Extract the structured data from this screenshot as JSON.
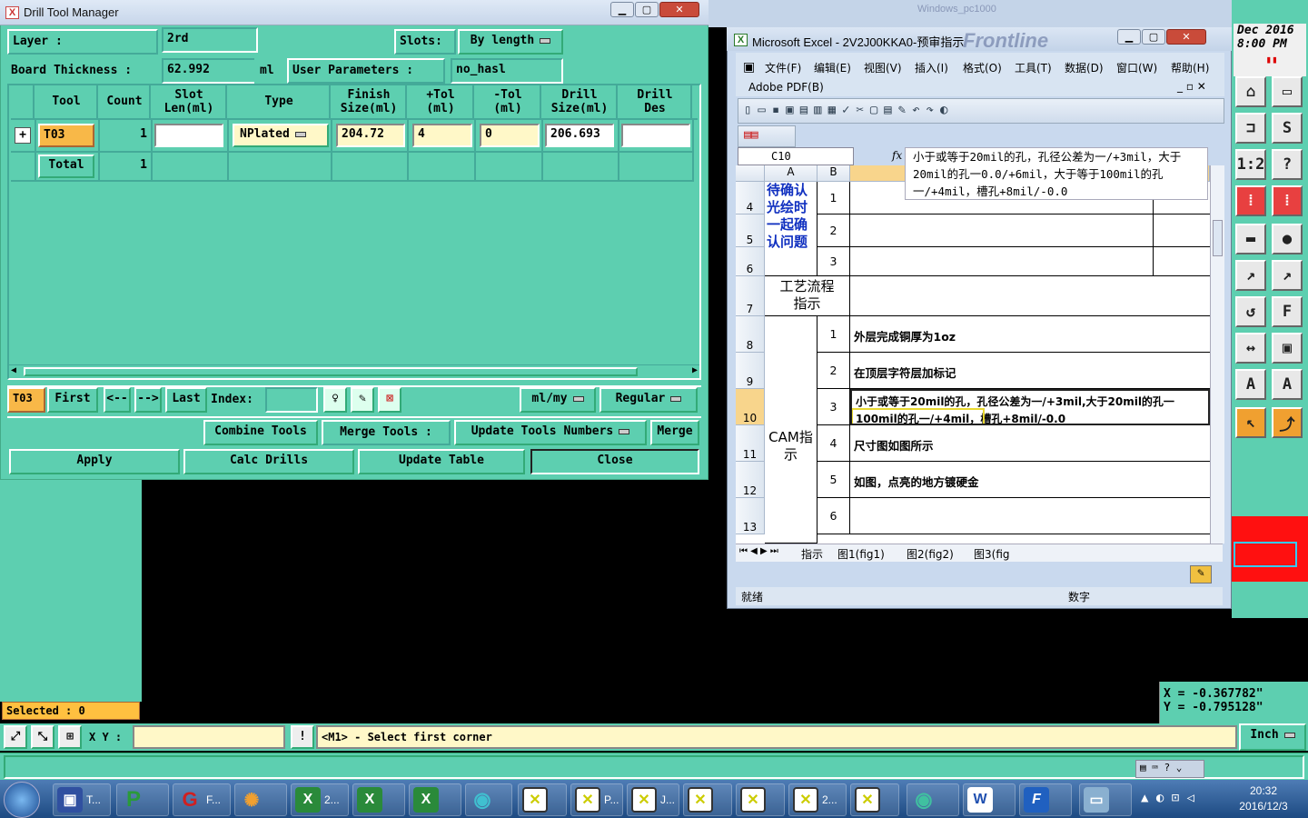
{
  "dtm": {
    "title": "Drill Tool Manager",
    "layer_label": "Layer :",
    "layer_value": "2rd",
    "slots_label": "Slots:",
    "slots_value": "By length",
    "board_thickness_label": "Board Thickness :",
    "board_thickness_value": "62.992",
    "board_thickness_unit": "ml",
    "user_params_label": "User Parameters :",
    "user_params_value": "no_hasl",
    "columns": [
      "Tool",
      "Count",
      "Slot\nLen(ml)",
      "Type",
      "Finish\nSize(ml)",
      "+Tol\n(ml)",
      "-Tol\n(ml)",
      "Drill\nSize(ml)",
      "Drill\nDes"
    ],
    "row1": {
      "tool": "T03",
      "count": "1",
      "slot_len": "",
      "type": "NPlated",
      "finish": "204.72",
      "ptol": "4",
      "ntol": "0",
      "drill": "206.693",
      "des": ""
    },
    "total_label": "Total",
    "total_count": "1",
    "nav_current": "T03",
    "nav_first": "First",
    "nav_prev": "<--",
    "nav_next": "-->",
    "nav_last": "Last",
    "index_label": "Index:",
    "unit_select": "ml/my",
    "mode_select": "Regular",
    "combine": "Combine Tools",
    "merge_tools": "Merge Tools :",
    "update_numbers": "Update Tools Numbers",
    "merge": "Merge",
    "apply": "Apply",
    "calc": "Calc Drills",
    "update_table": "Update Table",
    "close": "Close"
  },
  "genesis": {
    "date": "Dec 2016",
    "time": "8:00 PM",
    "coord_x": "X = -0.367782\"",
    "coord_y": "Y = -0.795128\"",
    "selected": "Selected : 0",
    "xy_label": "X Y :",
    "prompt": "<M1> - Select first corner",
    "unit": "Inch",
    "bg_logo": "Frontline",
    "bg_title": "Windows_pc1000"
  },
  "excel": {
    "title": "Microsoft Excel - 2V2J00KKA0-预审指示",
    "menus": [
      "文件(F)",
      "编辑(E)",
      "视图(V)",
      "插入(I)",
      "格式(O)",
      "工具(T)",
      "数据(D)",
      "窗口(W)",
      "帮助(H)"
    ],
    "adobe": "Adobe PDF(B)",
    "namebox": "C10",
    "fx": "fx",
    "formula": "小于或等于20mil的孔，孔径公差为一/+3mil，大于20mil的孔一0.0/+6mil，大于等于100mil的孔一/+4mil，槽孔+8mil/-0.0",
    "col_heads": [
      "A",
      "B",
      "C"
    ],
    "row_nums": [
      "4",
      "5",
      "6",
      "7",
      "8",
      "9",
      "10",
      "11",
      "12",
      "13"
    ],
    "confirm_text": "待确认光绘时一起确认问题",
    "nums_top": [
      "1",
      "2",
      "3"
    ],
    "process_label": "工艺流程指示",
    "cam_label": "CAM指示",
    "items": [
      {
        "n": "1",
        "t": "外层完成铜厚为1oz"
      },
      {
        "n": "2",
        "t": "在顶层字符层加标记"
      },
      {
        "n": "3",
        "t": "小于或等于20mil的孔，孔径公差为一/+3mil,大于20mil的孔一"
      },
      {
        "n": "4",
        "t": "尺寸图如图所示"
      },
      {
        "n": "5",
        "t": "如图，点亮的地方镀硬金"
      },
      {
        "n": "6",
        "t": ""
      }
    ],
    "item3_line2a": "100mil的孔一/+4mil，",
    "item3_line2b": "槽孔+8mil/-0.0",
    "tabs": [
      "指示",
      "图1(fig1)",
      "图2(fig2)",
      "图3(fig"
    ],
    "status_ready": "就绪",
    "status_num": "数字"
  },
  "taskbar": {
    "items": [
      "T...",
      "",
      "F...",
      "",
      "2...",
      "",
      "",
      "",
      "",
      "P...",
      "J...",
      "",
      "",
      "2...",
      "",
      "",
      "",
      ""
    ],
    "time": "20:32",
    "date": "2016/12/3"
  }
}
